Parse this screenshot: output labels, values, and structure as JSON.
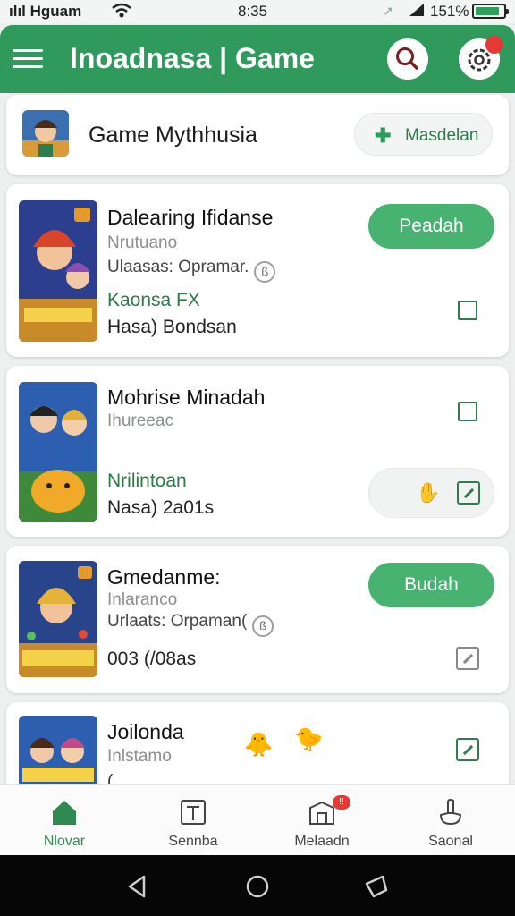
{
  "status_bar": {
    "carrier": "ılıl Hguam",
    "time": "8:35",
    "battery_pct": "151%",
    "battery_level": 0.85
  },
  "app_bar": {
    "title": "Inoadnasa | Game",
    "notification_count": ""
  },
  "featured": {
    "title": "Game Mythhusia",
    "button_label": "Masdelan"
  },
  "games": [
    {
      "title": "Dalearing Ifidanse",
      "subtitle": "Nrutuano",
      "meta": "Ulaasas: Opramar.",
      "tag": "Kaonsa FX",
      "date": "Hasa) Bondsan",
      "action_label": "Peadah"
    },
    {
      "title": "Mohrise Minadah",
      "subtitle": "Ihureeac",
      "tag": "Nrilintoan",
      "date": "Nasa) 2a01s"
    },
    {
      "title": "Gmedanme:",
      "subtitle": "Inlaranco",
      "meta": "Urlaats: Orpaman(",
      "date": "003 (/08as",
      "action_label": "Budah"
    },
    {
      "title": "Joilonda",
      "subtitle": "Inlstamo",
      "extra": "("
    }
  ],
  "bottom_nav": [
    {
      "label": "Nlovar",
      "icon": "home-icon",
      "active": true
    },
    {
      "label": "Sennba",
      "icon": "tablet-icon",
      "active": false
    },
    {
      "label": "Melaadn",
      "icon": "store-icon",
      "active": false,
      "badge": "!!"
    },
    {
      "label": "Saonal",
      "icon": "touch-icon",
      "active": false
    }
  ],
  "colors": {
    "primary": "#2f9a5c",
    "button": "#48b371",
    "accent_text": "#2a7b46",
    "badge": "#e53935"
  }
}
